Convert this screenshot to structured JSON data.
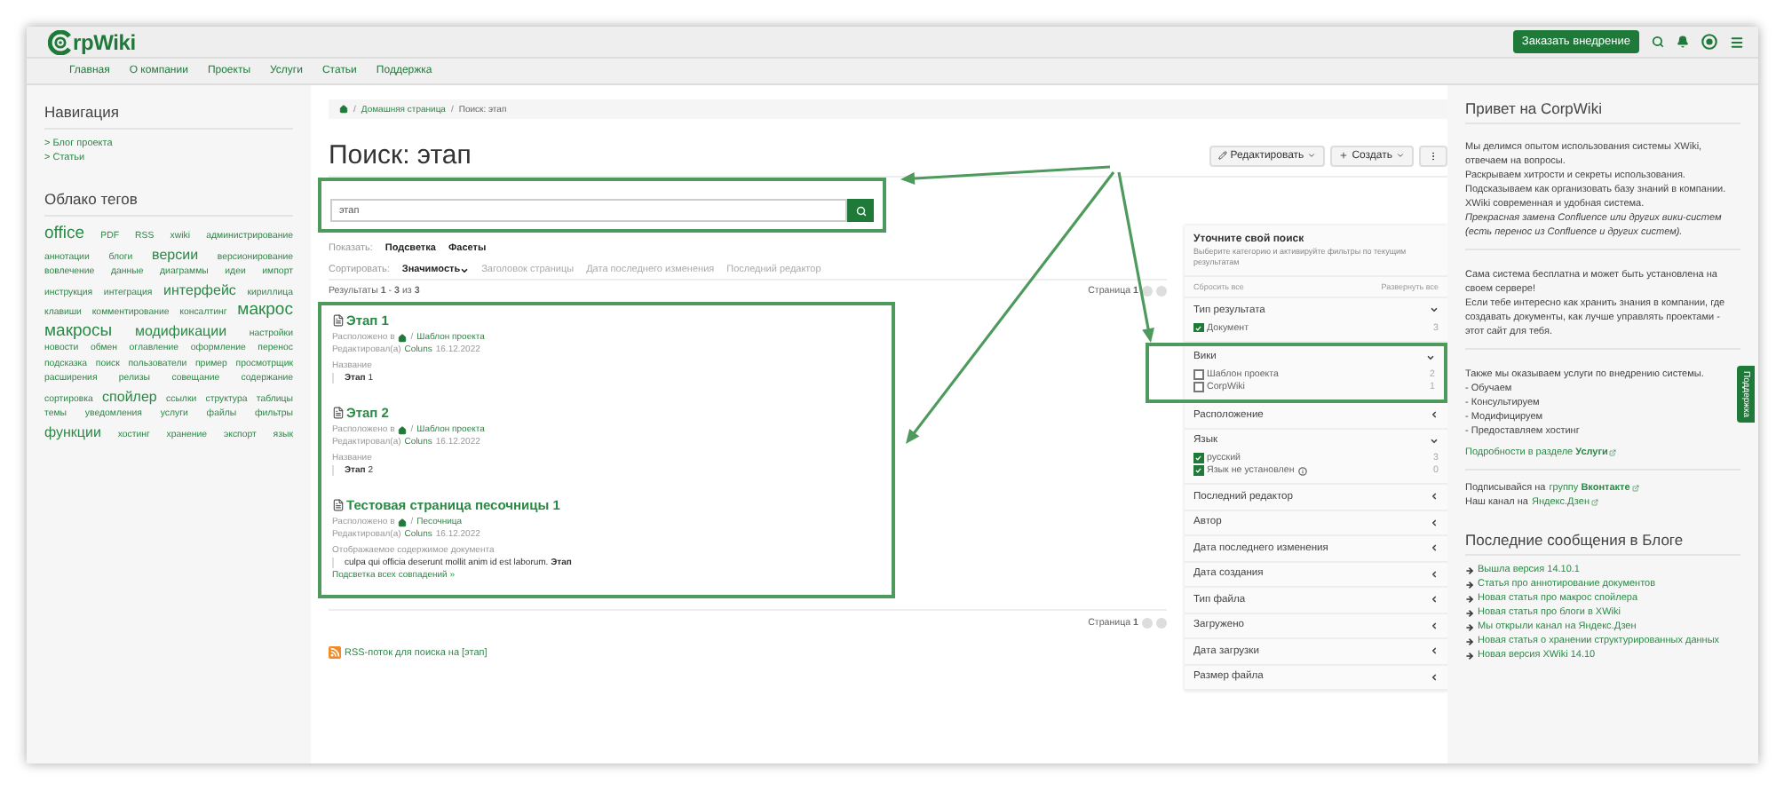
{
  "header": {
    "logo_text": "rpWiki",
    "cta": "Заказать внедрение",
    "nav": [
      "Главная",
      "О компании",
      "Проекты",
      "Услуги",
      "Статьи",
      "Поддержка"
    ]
  },
  "left": {
    "nav_title": "Навигация",
    "nav_items": [
      "> Блог проекта",
      "> Статьи"
    ],
    "tags_title": "Облако тегов",
    "tags": [
      {
        "label": "office",
        "kind": "xl"
      },
      {
        "label": "PDF",
        "kind": "s"
      },
      {
        "label": "RSS",
        "kind": "s"
      },
      {
        "label": "xwiki",
        "kind": "s"
      },
      {
        "label": "администрирование",
        "kind": "s"
      },
      {
        "label": "аннотации",
        "kind": "s"
      },
      {
        "label": "блоги",
        "kind": "s"
      },
      {
        "label": "версии",
        "kind": "l"
      },
      {
        "label": "версионирование",
        "kind": "s"
      },
      {
        "label": "вовлечение",
        "kind": "s"
      },
      {
        "label": "данные",
        "kind": "s"
      },
      {
        "label": "диаграммы",
        "kind": "s"
      },
      {
        "label": "идеи",
        "kind": "s"
      },
      {
        "label": "импорт",
        "kind": "s"
      },
      {
        "label": "инструкция",
        "kind": "s"
      },
      {
        "label": "интеграция",
        "kind": "s"
      },
      {
        "label": "интерфейс",
        "kind": "l"
      },
      {
        "label": "кириллица",
        "kind": "s"
      },
      {
        "label": "клавиши",
        "kind": "s"
      },
      {
        "label": "комментирование",
        "kind": "s"
      },
      {
        "label": "консалтинг",
        "kind": "s"
      },
      {
        "label": "макрос",
        "kind": "xl"
      },
      {
        "label": "макросы",
        "kind": "xl"
      },
      {
        "label": "модификации",
        "kind": "l"
      },
      {
        "label": "настройки",
        "kind": "s"
      },
      {
        "label": "новости",
        "kind": "s"
      },
      {
        "label": "обмен",
        "kind": "s"
      },
      {
        "label": "оглавление",
        "kind": "s"
      },
      {
        "label": "оформление",
        "kind": "s"
      },
      {
        "label": "перенос",
        "kind": "s"
      },
      {
        "label": "подсказка",
        "kind": "s"
      },
      {
        "label": "поиск",
        "kind": "s"
      },
      {
        "label": "пользователи",
        "kind": "s"
      },
      {
        "label": "пример",
        "kind": "s"
      },
      {
        "label": "просмотрщик",
        "kind": "s"
      },
      {
        "label": "расширения",
        "kind": "s"
      },
      {
        "label": "релизы",
        "kind": "s"
      },
      {
        "label": "совещание",
        "kind": "s"
      },
      {
        "label": "содержание",
        "kind": "s"
      },
      {
        "label": "сортировка",
        "kind": "s"
      },
      {
        "label": "спойлер",
        "kind": "l"
      },
      {
        "label": "ссылки",
        "kind": "s"
      },
      {
        "label": "структура",
        "kind": "s"
      },
      {
        "label": "таблицы",
        "kind": "s"
      },
      {
        "label": "темы",
        "kind": "s"
      },
      {
        "label": "уведомления",
        "kind": "s"
      },
      {
        "label": "услуги",
        "kind": "s"
      },
      {
        "label": "файлы",
        "kind": "s"
      },
      {
        "label": "фильтры",
        "kind": "s"
      },
      {
        "label": "функции",
        "kind": "l"
      },
      {
        "label": "хостинг",
        "kind": "s"
      },
      {
        "label": "хранение",
        "kind": "s"
      },
      {
        "label": "экспорт",
        "kind": "s"
      },
      {
        "label": "язык",
        "kind": "s"
      }
    ]
  },
  "main": {
    "separator": "/",
    "breadcrumb": [
      "Домашняя страница",
      "Поиск: этап"
    ],
    "title": "Поиск: этап",
    "actions": {
      "edit": "Редактировать",
      "create": "Создать"
    },
    "search": {
      "value": "этап",
      "annotated": true
    },
    "show": {
      "label": "Показать:",
      "options": [
        {
          "label": "Подсветка",
          "on": true
        },
        {
          "label": "Фасеты",
          "on": true
        }
      ]
    },
    "sort": {
      "label": "Сортировать:",
      "options": [
        {
          "label": "Значимость",
          "selected": true
        },
        {
          "label": "Заголовок страницы",
          "selected": false
        },
        {
          "label": "Дата последнего изменения",
          "selected": false
        },
        {
          "label": "Последний редактор",
          "selected": false
        }
      ]
    },
    "summary": "Результаты **1** - **3** из **3**",
    "page_top": "Страница **1**",
    "results_annotated": true,
    "results": [
      {
        "title": "Этап 1",
        "location_label": "Расположено в",
        "location": "Шаблон проекта",
        "edited_label": "Редактировал(а)",
        "editor": "Coluns",
        "date": "16.12.2022",
        "field": "Название",
        "snippet": "**Этап** 1"
      },
      {
        "title": "Этап 2",
        "location_label": "Расположено в",
        "location": "Шаблон проекта",
        "edited_label": "Редактировал(а)",
        "editor": "Coluns",
        "date": "16.12.2022",
        "field": "Название",
        "snippet": "**Этап** 2"
      },
      {
        "title": "Тестовая страница песочницы 1",
        "location_label": "Расположено в",
        "location": "Песочница",
        "edited_label": "Редактировал(а)",
        "editor": "Coluns",
        "date": "16.12.2022",
        "field": "Отображаемое содержимое документа",
        "snippet": "culpa qui officia deserunt mollit anim id est laborum. **Этап**",
        "more": "Подсветка всех совпадений »"
      }
    ],
    "page_bottom": "Страница **1**",
    "rss": "RSS-поток для поиска на [этап]"
  },
  "facets": {
    "title": "Уточните свой поиск",
    "description": "Выберите категорию и активируйте фильтры по текущим результатам",
    "reset": "Сбросить все",
    "expand": "Развернуть все",
    "groups": [
      {
        "name": "Тип результата",
        "expanded": true,
        "annotated": false,
        "items": [
          {
            "label": "Документ",
            "checked": true,
            "count": "3"
          }
        ]
      },
      {
        "name": "Вики",
        "expanded": true,
        "annotated": true,
        "items": [
          {
            "label": "Шаблон проекта",
            "checked": false,
            "count": "2"
          },
          {
            "label": "CorpWiki",
            "checked": false,
            "count": "1"
          }
        ]
      },
      {
        "name": "Расположение",
        "expanded": false,
        "annotated": false
      },
      {
        "name": "Язык",
        "expanded": true,
        "annotated": false,
        "items": [
          {
            "label": "русский",
            "checked": true,
            "count": "3"
          },
          {
            "label": "Язык не установлен",
            "checked": true,
            "count": "0",
            "info": true
          }
        ]
      },
      {
        "name": "Последний редактор",
        "expanded": false,
        "annotated": false
      },
      {
        "name": "Автор",
        "expanded": false,
        "annotated": false
      },
      {
        "name": "Дата последнего изменения",
        "expanded": false,
        "annotated": false
      },
      {
        "name": "Дата создания",
        "expanded": false,
        "annotated": false
      },
      {
        "name": "Тип файла",
        "expanded": false,
        "annotated": false
      },
      {
        "name": "Загружено",
        "expanded": false,
        "annotated": false
      },
      {
        "name": "Дата загрузки",
        "expanded": false,
        "annotated": false
      },
      {
        "name": "Размер файла",
        "expanded": false,
        "annotated": false
      }
    ]
  },
  "right": {
    "title": "Привет на CorpWiki",
    "intro": [
      "Мы делимся опытом использования системы XWiki, отвечаем на вопросы.",
      "Раскрываем хитрости и секреты использования.",
      "Подсказываем как организовать базу знаний в компании.",
      "XWiki современная и удобная система."
    ],
    "note": "Прекрасная замена Confluence или других вики-систем (есть перенос из Confluence и других систем).",
    "free": [
      "Сама система бесплатна и может быть установлена на своем сервере!",
      "Если тебе интересно как хранить знания в компании, где создавать документы, как лучше управлять проектами - этот сайт для тебя."
    ],
    "services": [
      "Также мы оказываем услуги по внедрению системы.",
      "- Обучаем",
      "- Консультируем",
      "- Модифицируем",
      "- Предоставляем хостинг"
    ],
    "services_link": "Подробности в разделе **Услуги**",
    "social": [
      {
        "text": "Подписывайся на",
        "link": "группу **Вконтакте**"
      },
      {
        "text": "Наш канал на",
        "link": "Яндекс.Дзен"
      }
    ],
    "blog_title": "Последние сообщения в Блоге",
    "blog": [
      "Вышла версия 14.10.1",
      "Статья про аннотирование документов",
      "Новая статья про макрос спойлера",
      "Новая статья про блоги в XWiki",
      "Мы открыли канал на Яндекс.Дзен",
      "Новая статья о хранении структурированных данных",
      "Новая версия XWiki 14.10"
    ]
  },
  "support_tab": "Поддержка"
}
